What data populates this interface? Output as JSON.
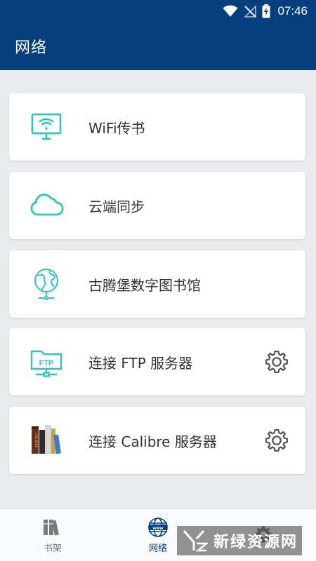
{
  "status_bar": {
    "time": "07:46"
  },
  "app_bar": {
    "title": "网络"
  },
  "cards": [
    {
      "label": "WiFi传书",
      "icon": "wifi-monitor-icon",
      "has_settings": false
    },
    {
      "label": "云端同步",
      "icon": "cloud-icon",
      "has_settings": false
    },
    {
      "label": "古腾堡数字图书馆",
      "icon": "globe-network-icon",
      "has_settings": false
    },
    {
      "label": "连接 FTP 服务器",
      "icon": "ftp-folder-icon",
      "has_settings": true
    },
    {
      "label": "连接 Calibre 服务器",
      "icon": "calibre-books-icon",
      "has_settings": true
    }
  ],
  "calibre_book_text": "CALIBRE",
  "ftp_icon_text": "FTP",
  "bottom_nav": [
    {
      "label": "书架",
      "icon": "bookshelf-icon",
      "active": false
    },
    {
      "label": "网络",
      "icon": "www-globe-icon",
      "active": true
    },
    {
      "label": "",
      "icon": "gear-icon",
      "active": false
    }
  ],
  "watermark": {
    "text": "新绿资源网"
  },
  "colors": {
    "primary": "#063f7d",
    "teal": "#2cc6bd",
    "background": "#e9ebee",
    "gear_gray": "#555555"
  }
}
